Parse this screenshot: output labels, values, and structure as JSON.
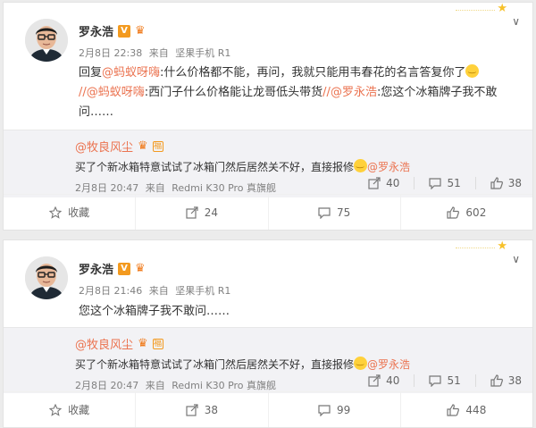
{
  "posts": [
    {
      "author": "罗永浩",
      "verified_badge": "V",
      "crown_icon": "crown-icon",
      "meta": {
        "date": "2月8日 22:38",
        "via": "来自",
        "source": "坚果手机 R1"
      },
      "body": {
        "reply_prefix": "回复",
        "mention_1": "@蚂蚁呀嗨",
        "text_1": ":什么价格都不能，再问，我就只能用韦春花的名言答复你了",
        "sep_1": "//",
        "mention_2": "@蚂蚁呀嗨",
        "text_2": ":西门子什么价格能让龙哥低头带货",
        "sep_2": "//",
        "mention_3": "@罗永浩",
        "text_3": ":您这个冰箱牌子我不敢问……"
      },
      "repost": {
        "name": "@牧良风尘",
        "text": "买了个新冰箱特意试试了冰箱门然后居然关不好，直接报修",
        "mention": "@罗永浩",
        "meta": {
          "date": "2月8日 20:47",
          "via": "来自",
          "source": "Redmi K30 Pro 真旗舰"
        },
        "stats": {
          "forward": "40",
          "comment": "51",
          "like": "38"
        }
      },
      "actions": {
        "collect": "收藏",
        "forward": "24",
        "comment": "75",
        "like": "602"
      }
    },
    {
      "author": "罗永浩",
      "verified_badge": "V",
      "crown_icon": "crown-icon",
      "meta": {
        "date": "2月8日 21:46",
        "via": "来自",
        "source": "坚果手机 R1"
      },
      "body": {
        "text": "您这个冰箱牌子我不敢问……"
      },
      "repost": {
        "name": "@牧良风尘",
        "text": "买了个新冰箱特意试试了冰箱门然后居然关不好，直接报修",
        "mention": "@罗永浩",
        "meta": {
          "date": "2月8日 20:47",
          "via": "来自",
          "source": "Redmi K30 Pro 真旗舰"
        },
        "stats": {
          "forward": "40",
          "comment": "51",
          "like": "38"
        }
      },
      "actions": {
        "collect": "收藏",
        "forward": "38",
        "comment": "99",
        "like": "448"
      }
    }
  ],
  "colors": {
    "link": "#eb7350",
    "repost_bg": "#f2f2f5",
    "badge": "#f39a1f"
  }
}
